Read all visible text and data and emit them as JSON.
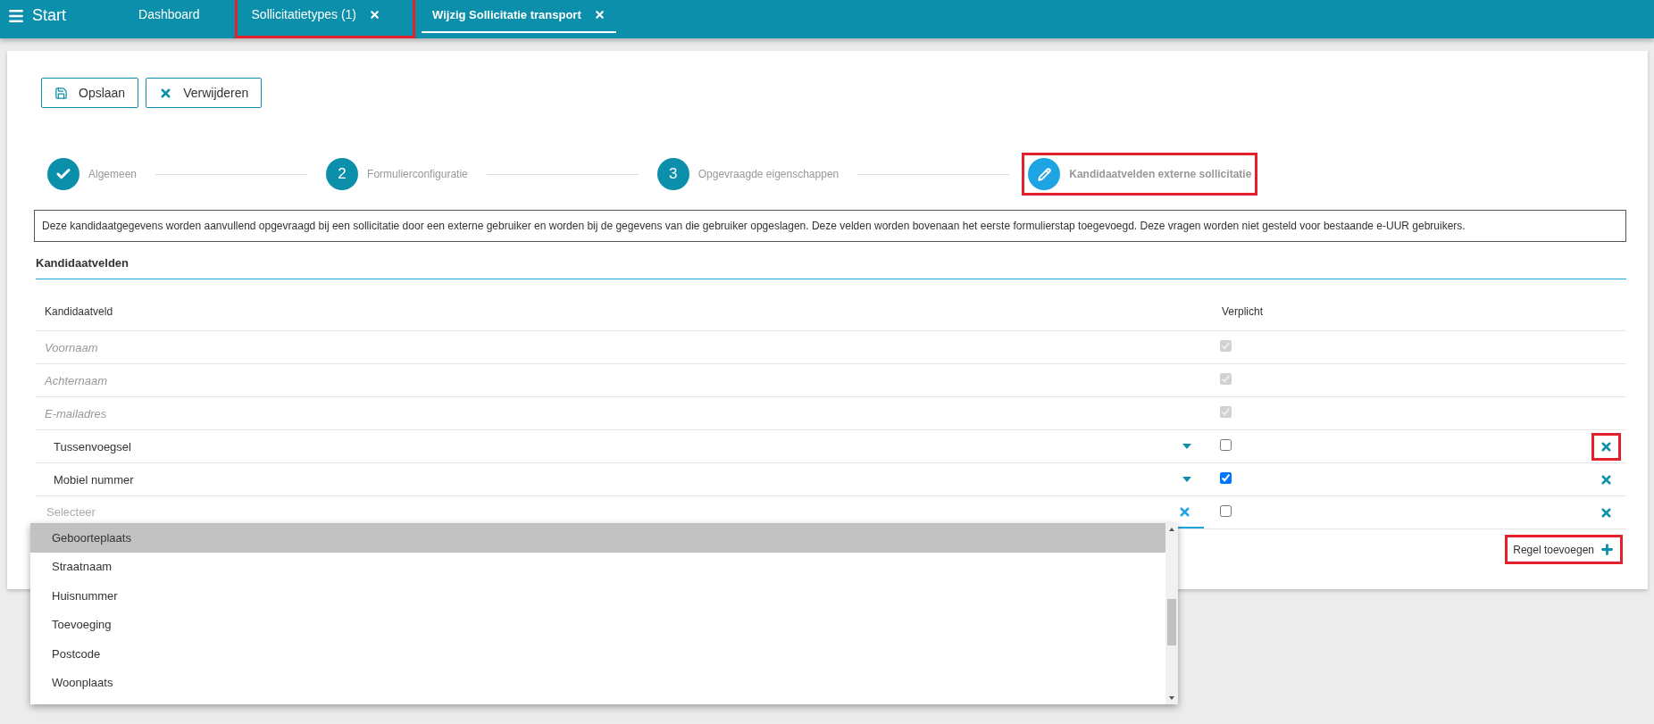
{
  "topbar": {
    "menu_label": "Start",
    "tabs": [
      {
        "label": "Dashboard",
        "selected": false,
        "closable": false,
        "highlighted": false
      },
      {
        "label": "Sollicitatietypes (1)",
        "selected": false,
        "closable": true,
        "highlighted": true
      },
      {
        "label": "Wijzig Sollicitatie transport",
        "selected": true,
        "closable": true,
        "highlighted": false
      }
    ]
  },
  "toolbar": [
    {
      "label": "Opslaan",
      "kind": "save"
    },
    {
      "label": "Verwijderen",
      "kind": "delete"
    }
  ],
  "steps": [
    {
      "kind": "done",
      "label": "Algemeen",
      "highlighted": false
    },
    {
      "kind": "number",
      "number": "2",
      "label": "Formulierconfiguratie",
      "highlighted": false
    },
    {
      "kind": "number",
      "number": "3",
      "label": "Opgevraagde eigenschappen",
      "highlighted": false
    },
    {
      "kind": "current",
      "label": "Kandidaatvelden externe sollicitatie",
      "highlighted": true
    }
  ],
  "info_text": "Deze kandidaatgegevens worden aanvullend opgevraagd bij een sollicitatie door een externe gebruiker en worden bij de gegevens van die gebruiker opgeslagen. Deze velden worden bovenaan het eerste formulierstap toegevoegd. Deze vragen worden niet gesteld voor bestaande e-UUR gebruikers.",
  "section_title": "Kandidaatvelden",
  "table": {
    "columns": [
      "Kandidaatveld",
      "Verplicht"
    ],
    "rows": [
      {
        "kind": "fixed",
        "field": "Voornaam",
        "required": true
      },
      {
        "kind": "fixed",
        "field": "Achternaam",
        "required": true
      },
      {
        "kind": "fixed",
        "field": "E-mailadres",
        "required": true
      },
      {
        "kind": "select",
        "field": "Tussenvoegsel",
        "required": false,
        "delete_highlighted": true
      },
      {
        "kind": "select",
        "field": "Mobiel nummer",
        "required": true,
        "delete_highlighted": false
      },
      {
        "kind": "search",
        "placeholder": "Selecteer",
        "required": false,
        "delete_highlighted": false
      }
    ]
  },
  "dropdown": {
    "options": [
      {
        "label": "Geboorteplaats",
        "selected": true
      },
      {
        "label": "Straatnaam",
        "selected": false
      },
      {
        "label": "Huisnummer",
        "selected": false
      },
      {
        "label": "Toevoeging",
        "selected": false
      },
      {
        "label": "Postcode",
        "selected": false
      },
      {
        "label": "Woonplaats",
        "selected": false
      }
    ]
  },
  "add_row_button": {
    "label": "Regel toevoegen",
    "highlighted": true
  }
}
